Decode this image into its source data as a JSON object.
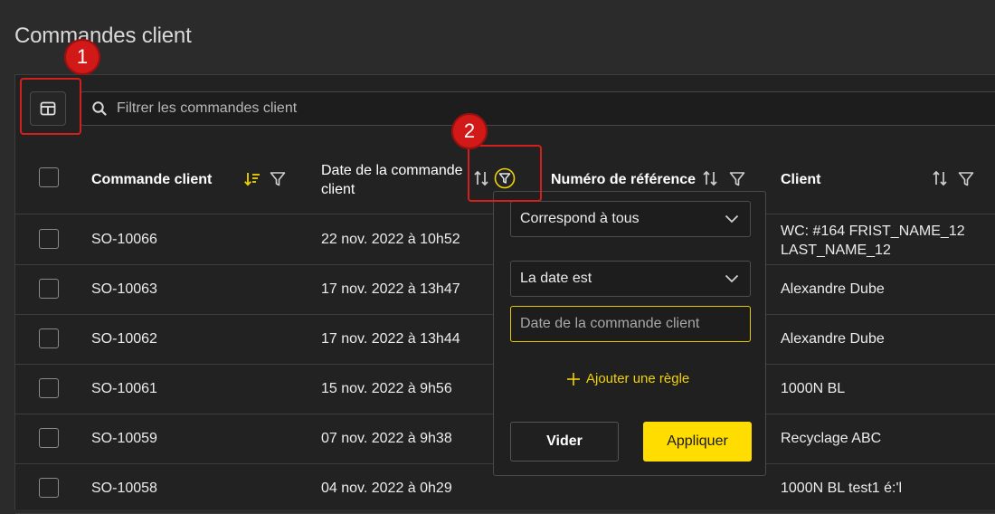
{
  "page": {
    "title": "Commandes client"
  },
  "search": {
    "placeholder": "Filtrer les commandes client"
  },
  "table": {
    "columns": [
      {
        "label": "Commande client"
      },
      {
        "label": "Date de la commande client"
      },
      {
        "label": "Numéro de référence"
      },
      {
        "label": "Client"
      }
    ],
    "rows": [
      {
        "order": "SO-10066",
        "date": "22 nov. 2022 à 10h52",
        "client": "WC: #164 FRIST_NAME_12 LAST_NAME_12"
      },
      {
        "order": "SO-10063",
        "date": "17 nov. 2022 à 13h47",
        "client": "Alexandre Dube"
      },
      {
        "order": "SO-10062",
        "date": "17 nov. 2022 à 13h44",
        "client": "Alexandre Dube"
      },
      {
        "order": "SO-10061",
        "date": "15 nov. 2022 à 9h56",
        "client": "1000N BL"
      },
      {
        "order": "SO-10059",
        "date": "07 nov. 2022 à 9h38",
        "client": "Recyclage ABC"
      },
      {
        "order": "SO-10058",
        "date": "04 nov. 2022 à 0h29",
        "client": "1000N BL test1 é:'l"
      }
    ]
  },
  "filter_popup": {
    "match_select": "Correspond à tous",
    "condition_select": "La date est",
    "date_placeholder": "Date de la commande client",
    "add_rule": "Ajouter une règle",
    "clear_button": "Vider",
    "apply_button": "Appliquer"
  },
  "annotations": [
    {
      "label": "1"
    },
    {
      "label": "2"
    }
  ],
  "colors": {
    "accent": "#ffdd00",
    "annotation": "#d11a17",
    "background": "#222222"
  },
  "icons": {
    "columns": "columns-icon",
    "search": "search-icon",
    "sort": "sort-icon",
    "sort_active": "sort-descending-icon",
    "filter": "filter-icon",
    "chevron": "chevron-down-icon",
    "plus": "plus-icon"
  }
}
